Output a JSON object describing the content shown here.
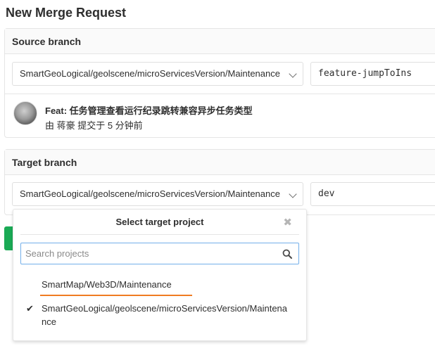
{
  "page": {
    "title": "New Merge Request"
  },
  "source": {
    "header": "Source branch",
    "project": "SmartGeoLogical/geolscene/microServicesVersion/Maintenance",
    "branch": "feature-jumpToIns",
    "commit": {
      "title": "Feat: 任务管理查看运行纪录跳转兼容异步任务类型",
      "meta": "由 蒋豪 提交于 5 分钟前"
    }
  },
  "target": {
    "header": "Target branch",
    "project": "SmartGeoLogical/geolscene/microServicesVersion/Maintenance",
    "branch": "dev"
  },
  "dropdown": {
    "title": "Select target project",
    "close_glyph": "✖",
    "search_placeholder": "Search projects",
    "search_value": "",
    "items": [
      {
        "label": "SmartMap/Web3D/Maintenance",
        "selected": false
      },
      {
        "label": "SmartGeoLogical/geolscene/microServicesVersion/Maintenance",
        "selected": true
      }
    ],
    "check_glyph": "✔"
  },
  "colors": {
    "accent_button": "#1aaa55",
    "highlight_underline": "#f07c22",
    "focus_border": "#73afea"
  }
}
